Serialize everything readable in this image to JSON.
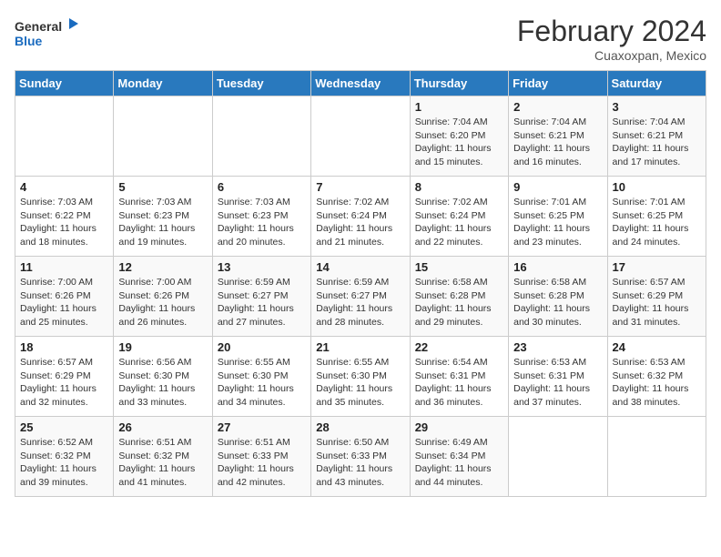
{
  "header": {
    "logo_general": "General",
    "logo_blue": "Blue",
    "month_title": "February 2024",
    "location": "Cuaxoxpan, Mexico"
  },
  "days_of_week": [
    "Sunday",
    "Monday",
    "Tuesday",
    "Wednesday",
    "Thursday",
    "Friday",
    "Saturday"
  ],
  "weeks": [
    [
      {
        "day": "",
        "info": ""
      },
      {
        "day": "",
        "info": ""
      },
      {
        "day": "",
        "info": ""
      },
      {
        "day": "",
        "info": ""
      },
      {
        "day": "1",
        "info": "Sunrise: 7:04 AM\nSunset: 6:20 PM\nDaylight: 11 hours and 15 minutes."
      },
      {
        "day": "2",
        "info": "Sunrise: 7:04 AM\nSunset: 6:21 PM\nDaylight: 11 hours and 16 minutes."
      },
      {
        "day": "3",
        "info": "Sunrise: 7:04 AM\nSunset: 6:21 PM\nDaylight: 11 hours and 17 minutes."
      }
    ],
    [
      {
        "day": "4",
        "info": "Sunrise: 7:03 AM\nSunset: 6:22 PM\nDaylight: 11 hours and 18 minutes."
      },
      {
        "day": "5",
        "info": "Sunrise: 7:03 AM\nSunset: 6:23 PM\nDaylight: 11 hours and 19 minutes."
      },
      {
        "day": "6",
        "info": "Sunrise: 7:03 AM\nSunset: 6:23 PM\nDaylight: 11 hours and 20 minutes."
      },
      {
        "day": "7",
        "info": "Sunrise: 7:02 AM\nSunset: 6:24 PM\nDaylight: 11 hours and 21 minutes."
      },
      {
        "day": "8",
        "info": "Sunrise: 7:02 AM\nSunset: 6:24 PM\nDaylight: 11 hours and 22 minutes."
      },
      {
        "day": "9",
        "info": "Sunrise: 7:01 AM\nSunset: 6:25 PM\nDaylight: 11 hours and 23 minutes."
      },
      {
        "day": "10",
        "info": "Sunrise: 7:01 AM\nSunset: 6:25 PM\nDaylight: 11 hours and 24 minutes."
      }
    ],
    [
      {
        "day": "11",
        "info": "Sunrise: 7:00 AM\nSunset: 6:26 PM\nDaylight: 11 hours and 25 minutes."
      },
      {
        "day": "12",
        "info": "Sunrise: 7:00 AM\nSunset: 6:26 PM\nDaylight: 11 hours and 26 minutes."
      },
      {
        "day": "13",
        "info": "Sunrise: 6:59 AM\nSunset: 6:27 PM\nDaylight: 11 hours and 27 minutes."
      },
      {
        "day": "14",
        "info": "Sunrise: 6:59 AM\nSunset: 6:27 PM\nDaylight: 11 hours and 28 minutes."
      },
      {
        "day": "15",
        "info": "Sunrise: 6:58 AM\nSunset: 6:28 PM\nDaylight: 11 hours and 29 minutes."
      },
      {
        "day": "16",
        "info": "Sunrise: 6:58 AM\nSunset: 6:28 PM\nDaylight: 11 hours and 30 minutes."
      },
      {
        "day": "17",
        "info": "Sunrise: 6:57 AM\nSunset: 6:29 PM\nDaylight: 11 hours and 31 minutes."
      }
    ],
    [
      {
        "day": "18",
        "info": "Sunrise: 6:57 AM\nSunset: 6:29 PM\nDaylight: 11 hours and 32 minutes."
      },
      {
        "day": "19",
        "info": "Sunrise: 6:56 AM\nSunset: 6:30 PM\nDaylight: 11 hours and 33 minutes."
      },
      {
        "day": "20",
        "info": "Sunrise: 6:55 AM\nSunset: 6:30 PM\nDaylight: 11 hours and 34 minutes."
      },
      {
        "day": "21",
        "info": "Sunrise: 6:55 AM\nSunset: 6:30 PM\nDaylight: 11 hours and 35 minutes."
      },
      {
        "day": "22",
        "info": "Sunrise: 6:54 AM\nSunset: 6:31 PM\nDaylight: 11 hours and 36 minutes."
      },
      {
        "day": "23",
        "info": "Sunrise: 6:53 AM\nSunset: 6:31 PM\nDaylight: 11 hours and 37 minutes."
      },
      {
        "day": "24",
        "info": "Sunrise: 6:53 AM\nSunset: 6:32 PM\nDaylight: 11 hours and 38 minutes."
      }
    ],
    [
      {
        "day": "25",
        "info": "Sunrise: 6:52 AM\nSunset: 6:32 PM\nDaylight: 11 hours and 39 minutes."
      },
      {
        "day": "26",
        "info": "Sunrise: 6:51 AM\nSunset: 6:32 PM\nDaylight: 11 hours and 41 minutes."
      },
      {
        "day": "27",
        "info": "Sunrise: 6:51 AM\nSunset: 6:33 PM\nDaylight: 11 hours and 42 minutes."
      },
      {
        "day": "28",
        "info": "Sunrise: 6:50 AM\nSunset: 6:33 PM\nDaylight: 11 hours and 43 minutes."
      },
      {
        "day": "29",
        "info": "Sunrise: 6:49 AM\nSunset: 6:34 PM\nDaylight: 11 hours and 44 minutes."
      },
      {
        "day": "",
        "info": ""
      },
      {
        "day": "",
        "info": ""
      }
    ]
  ]
}
